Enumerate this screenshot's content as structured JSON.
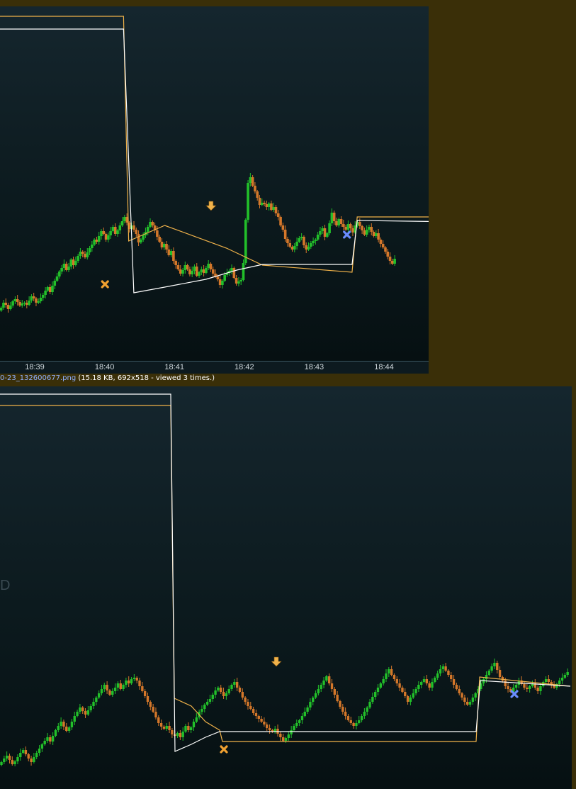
{
  "captions": {
    "top": {
      "fname": "",
      "info": ""
    },
    "bottom": {
      "fname": "0-23_132600677.png",
      "info": " (15.18 KB, 692x518 - viewed 3 times.)"
    }
  },
  "watermark": "D",
  "colors": {
    "bull": "#22c02a",
    "bear": "#d4772a",
    "orange_line": "#f0b24a",
    "white_line": "#ffffff",
    "sell_marker": "#f0b24a",
    "exit_marker": "#f0a030",
    "blue_marker": "#6a8cff"
  },
  "chart_data": [
    {
      "type": "candlestick",
      "title": "",
      "x_ticks": [
        "18:39",
        "18:40",
        "18:41",
        "18:42",
        "18:43",
        "18:44"
      ],
      "bars_per_minute": 30,
      "start_minute_offset": -0.48,
      "close": [
        434,
        427,
        430,
        436,
        431,
        425,
        422,
        426,
        431,
        428,
        427,
        430,
        424,
        418,
        421,
        427,
        425,
        420,
        416,
        410,
        405,
        412,
        403,
        396,
        390,
        383,
        378,
        372,
        381,
        376,
        366,
        374,
        368,
        361,
        355,
        358,
        363,
        356,
        350,
        345,
        338,
        341,
        333,
        326,
        330,
        338,
        332,
        326,
        320,
        330,
        325,
        318,
        312,
        306,
        314,
        323,
        318,
        324,
        330,
        342,
        338,
        332,
        327,
        320,
        313,
        318,
        325,
        334,
        341,
        349,
        344,
        352,
        360,
        354,
        368,
        374,
        380,
        386,
        381,
        374,
        380,
        387,
        382,
        376,
        389,
        384,
        380,
        385,
        378,
        372,
        380,
        386,
        390,
        394,
        402,
        396,
        388,
        385,
        382,
        378,
        392,
        400,
        397,
        395,
        371,
        310,
        258,
        250,
        262,
        270,
        279,
        289,
        286,
        288,
        292,
        287,
        296,
        292,
        301,
        306,
        318,
        324,
        337,
        343,
        348,
        352,
        347,
        341,
        336,
        334,
        346,
        352,
        348,
        343,
        340,
        338,
        331,
        326,
        322,
        334,
        329,
        315,
        300,
        312,
        318,
        309,
        316,
        320,
        324,
        316,
        322,
        328,
        318,
        313,
        319,
        325,
        331,
        324,
        320,
        327,
        333,
        329,
        338,
        344,
        349,
        355,
        362,
        368,
        372,
        365
      ],
      "line_orange": [
        [
          0.0,
          23
        ],
        [
          1.2,
          23
        ],
        [
          1.25,
          340
        ],
        [
          1.6,
          318
        ],
        [
          2.2,
          350
        ],
        [
          2.55,
          374
        ],
        [
          3.42,
          384
        ],
        [
          3.47,
          306
        ],
        [
          4.5,
          306
        ]
      ],
      "line_white": [
        [
          0.0,
          41
        ],
        [
          1.2,
          41
        ],
        [
          1.3,
          413
        ],
        [
          1.6,
          405
        ],
        [
          2.0,
          394
        ],
        [
          2.3,
          381
        ],
        [
          2.55,
          373
        ],
        [
          3.42,
          373
        ],
        [
          3.47,
          311
        ],
        [
          4.5,
          313
        ]
      ],
      "markers": [
        {
          "kind": "sell-arrow",
          "x": 2.05,
          "y": 291
        },
        {
          "kind": "exit-x",
          "x": 1.02,
          "y": 401
        },
        {
          "kind": "blue-x",
          "x": 3.37,
          "y": 331
        }
      ]
    },
    {
      "type": "candlestick",
      "title": "",
      "x_ticks": [],
      "close": [
        1075,
        1070,
        1066,
        1072,
        1078,
        1074,
        1068,
        1062,
        1058,
        1064,
        1070,
        1075,
        1068,
        1062,
        1056,
        1050,
        1045,
        1040,
        1046,
        1038,
        1030,
        1024,
        1018,
        1025,
        1031,
        1026,
        1018,
        1010,
        1004,
        998,
        1003,
        1008,
        1002,
        996,
        990,
        984,
        978,
        972,
        966,
        974,
        980,
        975,
        970,
        964,
        972,
        966,
        960,
        964,
        958,
        956,
        960,
        968,
        975,
        982,
        990,
        997,
        1004,
        1012,
        1020,
        1025,
        1028,
        1024,
        1030,
        1036,
        1038,
        1034,
        1040,
        1032,
        1024,
        1030,
        1026,
        1018,
        1012,
        1004,
        1000,
        994,
        990,
        986,
        980,
        974,
        970,
        976,
        982,
        978,
        972,
        966,
        962,
        970,
        976,
        984,
        990,
        996,
        1000,
        1006,
        1010,
        1014,
        1018,
        1022,
        1027,
        1030,
        1032,
        1028,
        1035,
        1040,
        1045,
        1041,
        1036,
        1030,
        1024,
        1020,
        1016,
        1010,
        1004,
        998,
        990,
        984,
        978,
        972,
        966,
        960,
        954,
        964,
        972,
        980,
        989,
        997,
        1004,
        1010,
        1016,
        1020,
        1024,
        1020,
        1016,
        1010,
        1004,
        998,
        990,
        983,
        976,
        970,
        964,
        958,
        950,
        944,
        952,
        958,
        964,
        970,
        976,
        982,
        990,
        984,
        978,
        972,
        966,
        962,
        958,
        964,
        970,
        962,
        956,
        950,
        944,
        940,
        946,
        952,
        958,
        966,
        972,
        978,
        984,
        990,
        994,
        990,
        984,
        978,
        972,
        964,
        958,
        952,
        946,
        940,
        935,
        945,
        955,
        960,
        968,
        972,
        976,
        970,
        966,
        960,
        965,
        970,
        972,
        968,
        964,
        970,
        975,
        968,
        962,
        958,
        962,
        966,
        970,
        965,
        960,
        956,
        952,
        948
      ],
      "line_orange": [
        [
          0,
          572
        ],
        [
          241,
          572
        ],
        [
          246,
          985
        ],
        [
          270,
          996
        ],
        [
          290,
          1018
        ],
        [
          310,
          1030
        ],
        [
          314,
          1046
        ],
        [
          672,
          1046
        ],
        [
          677,
          955
        ],
        [
          805,
          968
        ]
      ],
      "line_white": [
        [
          0,
          556
        ],
        [
          241,
          556
        ],
        [
          247,
          1060
        ],
        [
          270,
          1050
        ],
        [
          290,
          1040
        ],
        [
          310,
          1032
        ],
        [
          672,
          1032
        ],
        [
          678,
          960
        ],
        [
          805,
          968
        ]
      ],
      "markers": [
        {
          "kind": "sell-arrow",
          "x": 390,
          "y": 934
        },
        {
          "kind": "exit-x",
          "x": 316,
          "y": 1057
        },
        {
          "kind": "blue-x",
          "x": 726,
          "y": 979
        }
      ]
    }
  ]
}
